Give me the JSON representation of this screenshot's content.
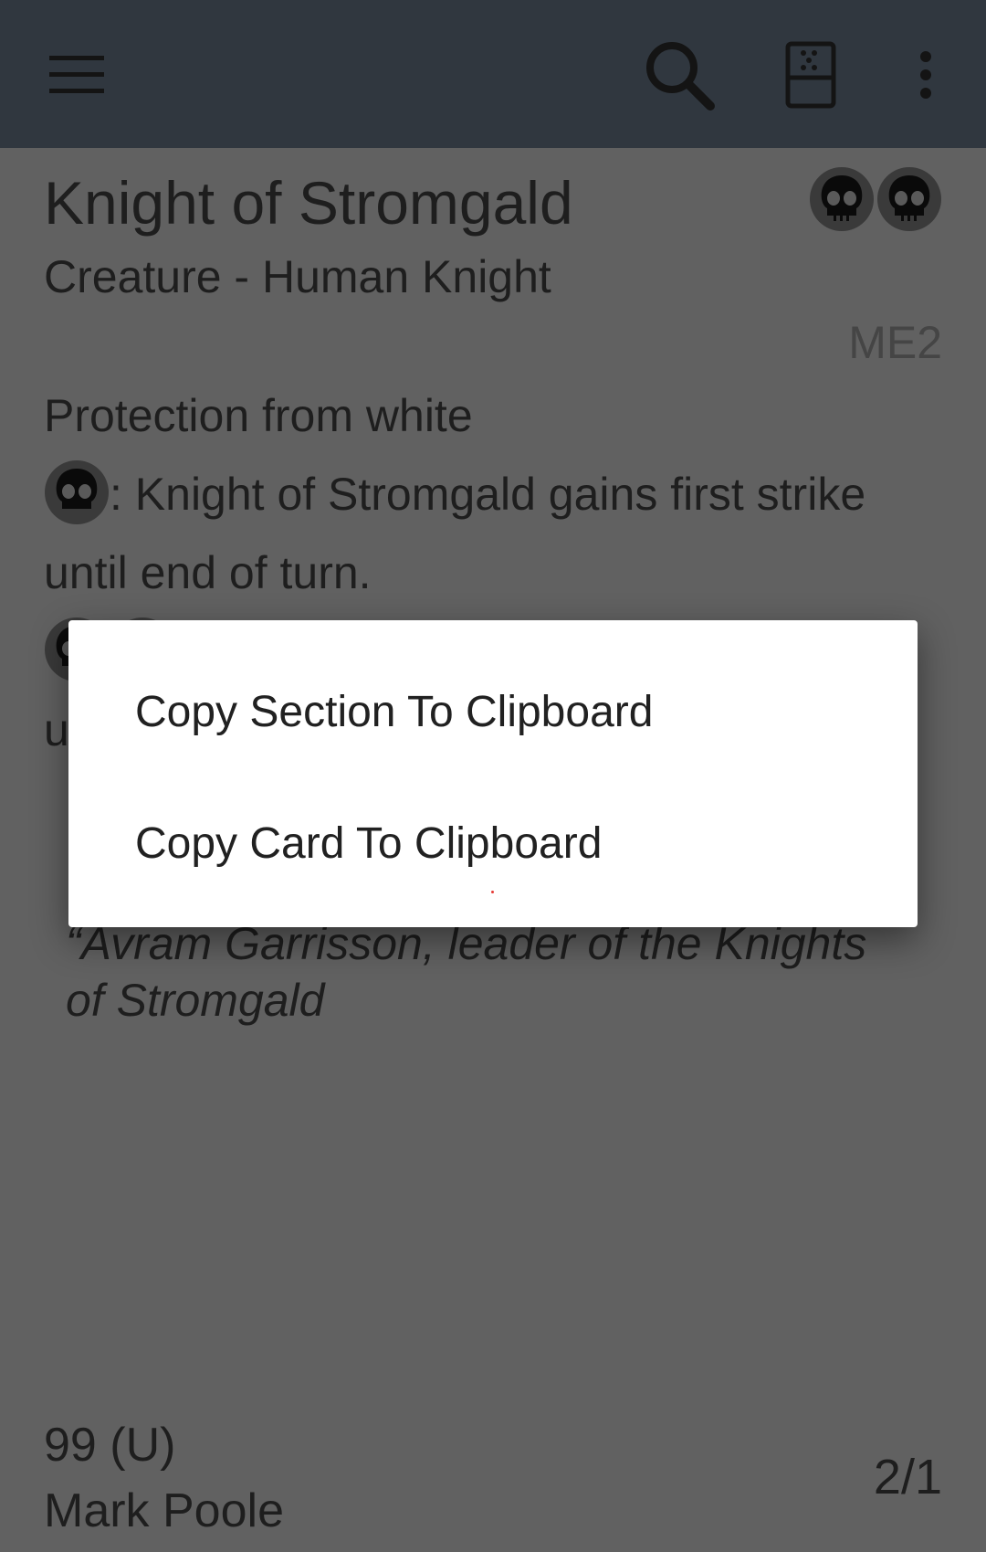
{
  "toolbar": {
    "menu_icon": "hamburger-menu-icon",
    "search_icon": "search-icon",
    "dice_icon": "dice-icon",
    "overflow_icon": "more-vert-icon",
    "background_color": "#30373f"
  },
  "card": {
    "name": "Knight of Stromgald",
    "type_line": "Creature - Human Knight",
    "mana_cost": [
      "black-mana-symbol",
      "black-mana-symbol"
    ],
    "set_code": "ME2",
    "rules_line1": "Protection from white",
    "rules_line2_text": ": Knight of Stromgald gains first strike",
    "rules_line3": "until end of turn.",
    "rules_line5_partial": "u",
    "flavor_line1": "“Avram Garrisson, leader of the Knights",
    "flavor_line2": "of Stromgald",
    "collector_number": "99 (U)",
    "artist": "Mark Poole",
    "power_toughness": "2/1"
  },
  "dialog": {
    "items": [
      {
        "label": "Copy Section To Clipboard"
      },
      {
        "label": "Copy Card To Clipboard"
      }
    ]
  }
}
